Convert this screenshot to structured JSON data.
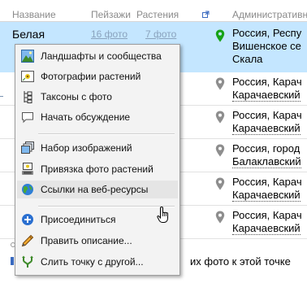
{
  "table": {
    "headers": {
      "name": "Название",
      "landscapes": "Пейзажи",
      "plants": "Растения",
      "admin": "Административн"
    },
    "rows": [
      {
        "name": "Белая",
        "landscapes": "16 фото",
        "plants": "7 фото",
        "region": [
          "Россия, Респу",
          "Вишенское се",
          "Скала"
        ]
      },
      {
        "region": [
          "Россия, Карач",
          "Карачаевский"
        ]
      },
      {
        "region": [
          "Россия, Карач",
          "Карачаевский"
        ]
      },
      {
        "region": [
          "Россия, город",
          "Балаклавский"
        ]
      },
      {
        "region": [
          "Россия, Карач",
          "Карачаевский"
        ]
      },
      {
        "region": [
          "Россия, Карач",
          "Карачаевский"
        ]
      }
    ]
  },
  "bottom_text": "их фото к этой точке",
  "menu": {
    "items": [
      {
        "label": "Ландшафты и сообщества",
        "icon": "landscape-icon"
      },
      {
        "label": "Фотографии растений",
        "icon": "plant-photo-icon"
      },
      {
        "label": "Таксоны с фото",
        "icon": "taxa-tree-icon"
      },
      {
        "label": "Начать обсуждение",
        "icon": "comment-icon"
      },
      {
        "label": "Набор изображений",
        "icon": "image-set-icon"
      },
      {
        "label": "Привязка фото растений",
        "icon": "photo-link-icon"
      },
      {
        "label": "Ссылки на веб-ресурсы",
        "icon": "globe-icon"
      },
      {
        "label": "Присоединиться",
        "icon": "plus-circle-icon"
      },
      {
        "label": "Править описание...",
        "icon": "pencil-icon"
      },
      {
        "label": "Слить точку с другой...",
        "icon": "merge-icon"
      }
    ]
  }
}
